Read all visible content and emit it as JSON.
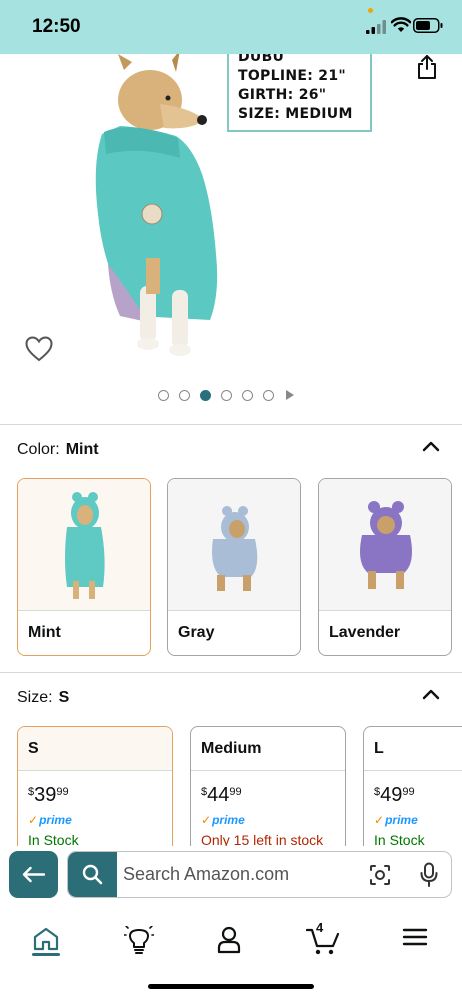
{
  "status_bar": {
    "time": "12:50"
  },
  "product_image": {
    "spec_lines": [
      "DUBU",
      "TOPLINE: 21\"",
      "GIRTH: 26\"",
      "SIZE: MEDIUM"
    ],
    "image_dots_total": 6,
    "image_dots_active": 3,
    "share_icon": "share-icon",
    "heart_icon": "heart-icon"
  },
  "color_section": {
    "label": "Color:",
    "selected": "Mint",
    "options": [
      {
        "label": "Mint",
        "color": "#5fc9c3"
      },
      {
        "label": "Gray",
        "color": "#a9bdd6"
      },
      {
        "label": "Lavender",
        "color": "#8a74c4"
      }
    ]
  },
  "size_section": {
    "label": "Size:",
    "selected": "S",
    "options": [
      {
        "label": "S",
        "price_dollar": "$",
        "price_whole": "39",
        "price_cents": "99",
        "prime": "prime",
        "stock": "In Stock"
      },
      {
        "label": "Medium",
        "price_dollar": "$",
        "price_whole": "44",
        "price_cents": "99",
        "prime": "prime",
        "stock": "Only 15 left in stock"
      },
      {
        "label": "L",
        "price_dollar": "$",
        "price_whole": "49",
        "price_cents": "99",
        "prime": "prime",
        "stock": "In Stock"
      }
    ]
  },
  "search": {
    "placeholder": "Search Amazon.com"
  },
  "bottom_nav": {
    "cart_count": "4",
    "items": [
      "home-icon",
      "lightbulb-icon",
      "account-icon",
      "cart-icon",
      "menu-icon"
    ]
  },
  "colors": {
    "accent": "#2b6e78",
    "status_bar_bg": "#a6e3e0",
    "selected_border": "#e3a15c",
    "in_stock": "#007600",
    "low_stock": "#b12704",
    "prime_blue": "#1a98ff"
  }
}
